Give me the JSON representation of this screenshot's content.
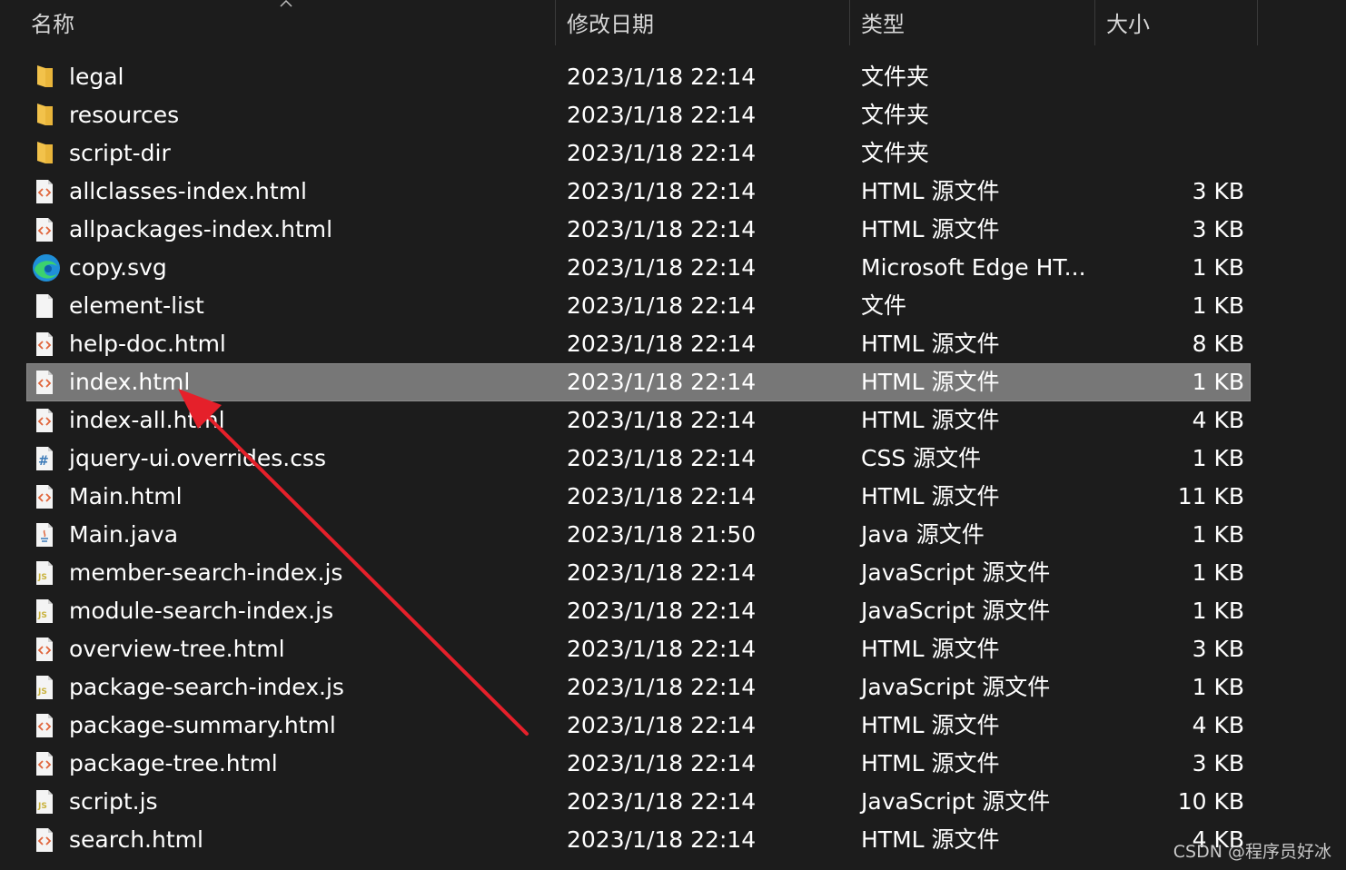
{
  "columns": {
    "name": "名称",
    "date": "修改日期",
    "type": "类型",
    "size": "大小"
  },
  "files": [
    {
      "name": "legal",
      "date": "2023/1/18 22:14",
      "type": "文件夹",
      "size": "",
      "icon": "folder-icon"
    },
    {
      "name": "resources",
      "date": "2023/1/18 22:14",
      "type": "文件夹",
      "size": "",
      "icon": "folder-icon"
    },
    {
      "name": "script-dir",
      "date": "2023/1/18 22:14",
      "type": "文件夹",
      "size": "",
      "icon": "folder-icon"
    },
    {
      "name": "allclasses-index.html",
      "date": "2023/1/18 22:14",
      "type": "HTML 源文件",
      "size": "3 KB",
      "icon": "html-file-icon"
    },
    {
      "name": "allpackages-index.html",
      "date": "2023/1/18 22:14",
      "type": "HTML 源文件",
      "size": "3 KB",
      "icon": "html-file-icon"
    },
    {
      "name": "copy.svg",
      "date": "2023/1/18 22:14",
      "type": "Microsoft Edge HT...",
      "size": "1 KB",
      "icon": "edge-icon"
    },
    {
      "name": "element-list",
      "date": "2023/1/18 22:14",
      "type": "文件",
      "size": "1 KB",
      "icon": "blank-file-icon"
    },
    {
      "name": "help-doc.html",
      "date": "2023/1/18 22:14",
      "type": "HTML 源文件",
      "size": "8 KB",
      "icon": "html-file-icon"
    },
    {
      "name": "index.html",
      "date": "2023/1/18 22:14",
      "type": "HTML 源文件",
      "size": "1 KB",
      "icon": "html-file-icon",
      "selected": true
    },
    {
      "name": "index-all.html",
      "date": "2023/1/18 22:14",
      "type": "HTML 源文件",
      "size": "4 KB",
      "icon": "html-file-icon"
    },
    {
      "name": "jquery-ui.overrides.css",
      "date": "2023/1/18 22:14",
      "type": "CSS 源文件",
      "size": "1 KB",
      "icon": "css-file-icon"
    },
    {
      "name": "Main.html",
      "date": "2023/1/18 22:14",
      "type": "HTML 源文件",
      "size": "11 KB",
      "icon": "html-file-icon"
    },
    {
      "name": "Main.java",
      "date": "2023/1/18 21:50",
      "type": "Java 源文件",
      "size": "1 KB",
      "icon": "java-file-icon"
    },
    {
      "name": "member-search-index.js",
      "date": "2023/1/18 22:14",
      "type": "JavaScript 源文件",
      "size": "1 KB",
      "icon": "js-file-icon"
    },
    {
      "name": "module-search-index.js",
      "date": "2023/1/18 22:14",
      "type": "JavaScript 源文件",
      "size": "1 KB",
      "icon": "js-file-icon"
    },
    {
      "name": "overview-tree.html",
      "date": "2023/1/18 22:14",
      "type": "HTML 源文件",
      "size": "3 KB",
      "icon": "html-file-icon"
    },
    {
      "name": "package-search-index.js",
      "date": "2023/1/18 22:14",
      "type": "JavaScript 源文件",
      "size": "1 KB",
      "icon": "js-file-icon"
    },
    {
      "name": "package-summary.html",
      "date": "2023/1/18 22:14",
      "type": "HTML 源文件",
      "size": "4 KB",
      "icon": "html-file-icon"
    },
    {
      "name": "package-tree.html",
      "date": "2023/1/18 22:14",
      "type": "HTML 源文件",
      "size": "3 KB",
      "icon": "html-file-icon"
    },
    {
      "name": "script.js",
      "date": "2023/1/18 22:14",
      "type": "JavaScript 源文件",
      "size": "10 KB",
      "icon": "js-file-icon"
    },
    {
      "name": "search.html",
      "date": "2023/1/18 22:14",
      "type": "HTML 源文件",
      "size": "4 KB",
      "icon": "html-file-icon"
    }
  ],
  "watermark": "CSDN @程序员好冰",
  "colors": {
    "background": "#1c1c1c",
    "selection": "#777777",
    "annotation_arrow": "#e5202a",
    "folder": "#f2c24b",
    "html_icon": "#e0643a",
    "js_icon": "#c9b23c",
    "css_icon": "#3b7ab8"
  }
}
